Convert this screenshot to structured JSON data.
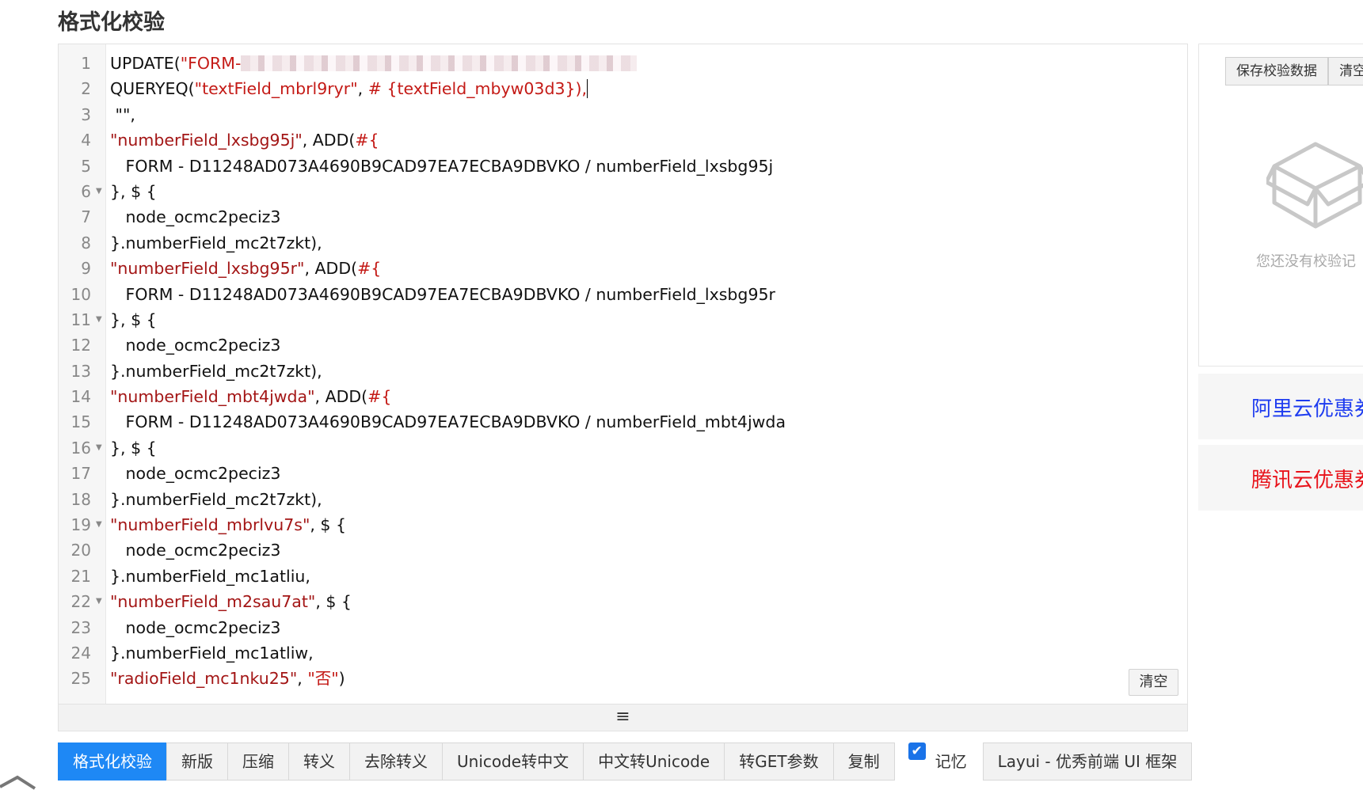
{
  "page": {
    "title": "格式化校验"
  },
  "editor": {
    "lines": [
      {
        "n": "1",
        "fold": false,
        "parts": [
          {
            "t": "UPDATE(",
            "c": ""
          },
          {
            "t": "\"FORM-",
            "c": "s"
          }
        ],
        "redacted": true
      },
      {
        "n": "2",
        "fold": false,
        "parts": [
          {
            "t": "QUERYEQ(",
            "c": ""
          },
          {
            "t": "\"textField_mbrl9ryr\"",
            "c": "s"
          },
          {
            "t": ", ",
            "c": ""
          },
          {
            "t": "# {textField_mbyw03d3}),",
            "c": "s"
          }
        ],
        "caret": true
      },
      {
        "n": "3",
        "fold": false,
        "parts": [
          {
            "t": " \"\",",
            "c": ""
          }
        ]
      },
      {
        "n": "4",
        "fold": false,
        "parts": [
          {
            "t": "\"numberField_lxsbg95j\"",
            "c": "s2"
          },
          {
            "t": ", ADD(",
            "c": ""
          },
          {
            "t": "#{",
            "c": "s"
          }
        ]
      },
      {
        "n": "5",
        "fold": false,
        "parts": [
          {
            "t": "   FORM - D11248AD073A4690B9CAD97EA7ECBA9DBVKO / numberField_lxsbg95j",
            "c": ""
          }
        ]
      },
      {
        "n": "6",
        "fold": true,
        "parts": [
          {
            "t": "}, $ {",
            "c": ""
          }
        ]
      },
      {
        "n": "7",
        "fold": false,
        "parts": [
          {
            "t": "   node_ocmc2peciz3",
            "c": ""
          }
        ]
      },
      {
        "n": "8",
        "fold": false,
        "parts": [
          {
            "t": "}.numberField_mc2t7zkt),",
            "c": ""
          }
        ]
      },
      {
        "n": "9",
        "fold": false,
        "parts": [
          {
            "t": "\"numberField_lxsbg95r\"",
            "c": "s2"
          },
          {
            "t": ", ADD(",
            "c": ""
          },
          {
            "t": "#{",
            "c": "s"
          }
        ]
      },
      {
        "n": "10",
        "fold": false,
        "parts": [
          {
            "t": "   FORM - D11248AD073A4690B9CAD97EA7ECBA9DBVKO / numberField_lxsbg95r",
            "c": ""
          }
        ]
      },
      {
        "n": "11",
        "fold": true,
        "parts": [
          {
            "t": "}, $ {",
            "c": ""
          }
        ]
      },
      {
        "n": "12",
        "fold": false,
        "parts": [
          {
            "t": "   node_ocmc2peciz3",
            "c": ""
          }
        ]
      },
      {
        "n": "13",
        "fold": false,
        "parts": [
          {
            "t": "}.numberField_mc2t7zkt),",
            "c": ""
          }
        ]
      },
      {
        "n": "14",
        "fold": false,
        "parts": [
          {
            "t": "\"numberField_mbt4jwda\"",
            "c": "s2"
          },
          {
            "t": ", ADD(",
            "c": ""
          },
          {
            "t": "#{",
            "c": "s"
          }
        ]
      },
      {
        "n": "15",
        "fold": false,
        "parts": [
          {
            "t": "   FORM - D11248AD073A4690B9CAD97EA7ECBA9DBVKO / numberField_mbt4jwda",
            "c": ""
          }
        ]
      },
      {
        "n": "16",
        "fold": true,
        "parts": [
          {
            "t": "}, $ {",
            "c": ""
          }
        ]
      },
      {
        "n": "17",
        "fold": false,
        "parts": [
          {
            "t": "   node_ocmc2peciz3",
            "c": ""
          }
        ]
      },
      {
        "n": "18",
        "fold": false,
        "parts": [
          {
            "t": "}.numberField_mc2t7zkt),",
            "c": ""
          }
        ]
      },
      {
        "n": "19",
        "fold": true,
        "parts": [
          {
            "t": "\"numberField_mbrlvu7s\"",
            "c": "s2"
          },
          {
            "t": ", $ {",
            "c": ""
          }
        ]
      },
      {
        "n": "20",
        "fold": false,
        "parts": [
          {
            "t": "   node_ocmc2peciz3",
            "c": ""
          }
        ]
      },
      {
        "n": "21",
        "fold": false,
        "parts": [
          {
            "t": "}.numberField_mc1atliu,",
            "c": ""
          }
        ]
      },
      {
        "n": "22",
        "fold": true,
        "parts": [
          {
            "t": "\"numberField_m2sau7at\"",
            "c": "s2"
          },
          {
            "t": ", $ {",
            "c": ""
          }
        ]
      },
      {
        "n": "23",
        "fold": false,
        "parts": [
          {
            "t": "   node_ocmc2peciz3",
            "c": ""
          }
        ]
      },
      {
        "n": "24",
        "fold": false,
        "parts": [
          {
            "t": "}.numberField_mc1atliw,",
            "c": ""
          }
        ]
      },
      {
        "n": "25",
        "fold": false,
        "parts": [
          {
            "t": "\"radioField_mc1nku25\"",
            "c": "s2"
          },
          {
            "t": ", ",
            "c": ""
          },
          {
            "t": "\"否\"",
            "c": "s"
          },
          {
            "t": ")",
            "c": ""
          }
        ]
      }
    ],
    "clear_label": "清空",
    "resize_handle": "≡"
  },
  "side": {
    "save_label": "保存校验数据",
    "clear_label": "清空",
    "empty_text": "您还没有校验记",
    "aliyun_label": "阿里云优惠券",
    "tencent_label": "腾讯云优惠券",
    "aliyun_color": "#1e3cf0",
    "tencent_color": "#e8121a"
  },
  "toolbar": {
    "buttons": [
      "格式化校验",
      "新版",
      "压缩",
      "转义",
      "去除转义",
      "Unicode转中文",
      "中文转Unicode",
      "转GET参数",
      "复制"
    ],
    "memory_label": "记忆",
    "memory_checked": true,
    "layui_label": "Layui - 优秀前端 UI 框架",
    "primary_color": "#1e88f5"
  }
}
